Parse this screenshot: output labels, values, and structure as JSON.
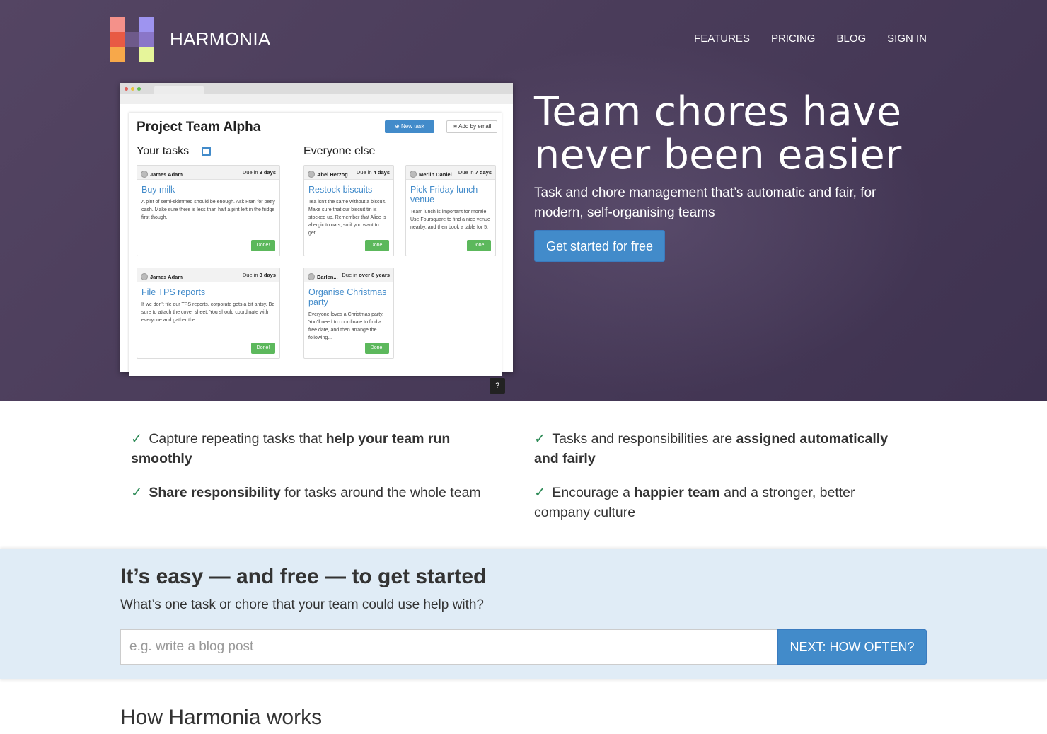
{
  "brand": {
    "name": "HARMONIA",
    "logo_colors": [
      "#f4918a",
      "#ffffff00",
      "#9e94f0",
      "#e85a44",
      "#6e5a8a",
      "#8a76c8",
      "#f7a84a",
      "#ffffff00",
      "#e6f59a"
    ]
  },
  "nav": {
    "features": "FEATURES",
    "pricing": "PRICING",
    "blog": "BLOG",
    "sign_in": "SIGN IN"
  },
  "preview": {
    "project_title": "Project Team Alpha",
    "new_task": "⊕ New task",
    "add_by_email": "✉ Add by email",
    "your_tasks": "Your tasks",
    "everyone_else": "Everyone else",
    "help": "?",
    "cards": [
      {
        "who": "James Adam",
        "due_prefix": "Due in",
        "due": "3 days",
        "title": "Buy milk",
        "desc": "A pint of semi-skimmed should be enough. Ask Fran for petty cash. Make sure there is less than half a pint left in the fridge first though.",
        "done": "Done!"
      },
      {
        "who": "Abel Herzog",
        "due_prefix": "Due in",
        "due": "4 days",
        "title": "Restock biscuits",
        "desc": "Tea isn't the same without a biscuit. Make sure that our biscuit tin is stocked up. Remember that Alice is allergic to oats, so if you want to get...",
        "done": "Done!"
      },
      {
        "who": "Merlin Daniel",
        "due_prefix": "Due in",
        "due": "7 days",
        "title": "Pick Friday lunch venue",
        "desc": "Team lunch is important for morale. Use Foursquare to find a nice venue nearby, and then book a table for 5.",
        "done": "Done!"
      },
      {
        "who": "James Adam",
        "due_prefix": "Due in",
        "due": "3 days",
        "title": "File TPS reports",
        "desc": "If we don't file our TPS reports, corporate gets a bit antsy. Be sure to attach the cover sheet. You should coordinate with everyone and gather the...",
        "done": "Done!"
      },
      {
        "who": "Darlen...",
        "due_prefix": "Due in",
        "due": "over 8 years",
        "title": "Organise Christmas party",
        "desc": "Everyone loves a Christmas party. You'll need to coordinate to find a free date, and then arrange the following...",
        "done": "Done!"
      }
    ]
  },
  "hero": {
    "headline": "Team chores have never been easier",
    "subhead": "Task and chore management that’s automatic and fair, for modern, self-organising teams",
    "cta": "Get started for free"
  },
  "features": [
    {
      "check": "✓",
      "pre": "Capture repeating tasks that ",
      "bold": "help your team run smoothly",
      "post": ""
    },
    {
      "check": "✓",
      "pre": "Tasks and responsibilities are ",
      "bold": "assigned automatically and fairly",
      "post": ""
    },
    {
      "check": "✓",
      "pre": "",
      "bold": "Share responsibility",
      "post": " for tasks around the whole team"
    },
    {
      "check": "✓",
      "pre": "Encourage a ",
      "bold": "happier team",
      "post": " and a stronger, better company culture"
    }
  ],
  "signup": {
    "heading": "It’s easy — and free — to get started",
    "question": "What’s one task or chore that your team could use help with?",
    "placeholder": "e.g. write a blog post",
    "next": "NEXT: HOW OFTEN?"
  },
  "how": {
    "heading": "How Harmonia works"
  },
  "colors": {
    "accent": "#428bca",
    "done_green": "#5cb85c",
    "hero_bg": "#4a3c5a",
    "band_bg": "#e0ecf6"
  }
}
